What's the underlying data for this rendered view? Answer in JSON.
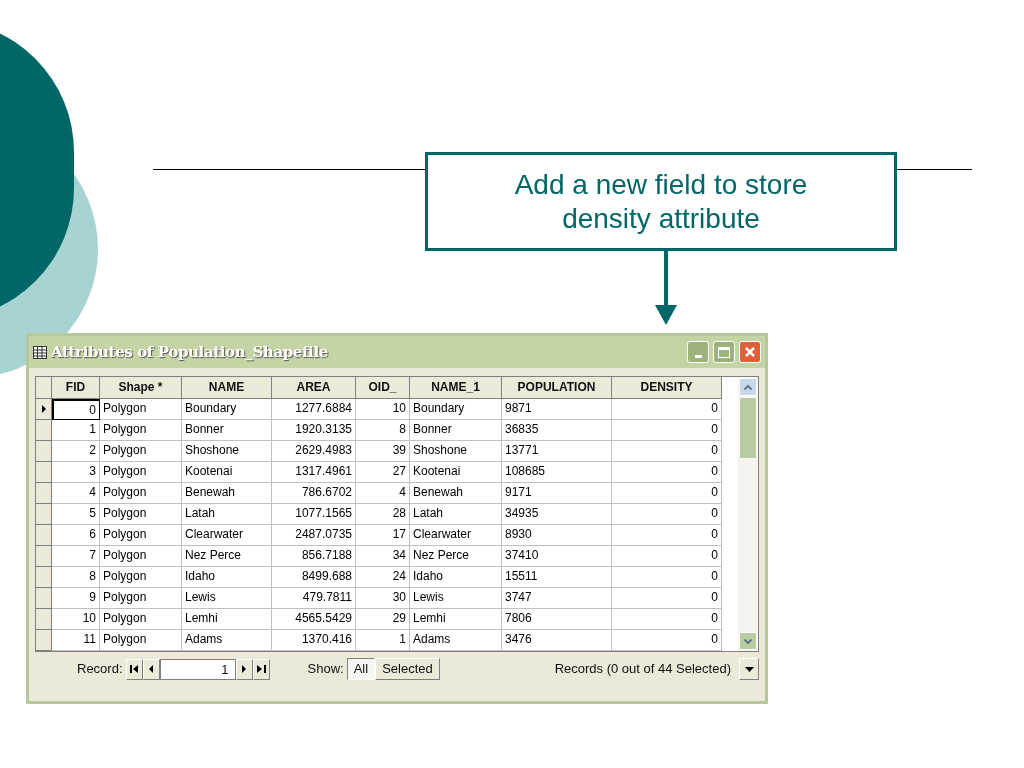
{
  "callout": {
    "text": "Add a new field to store density attribute"
  },
  "window": {
    "title": "Attributes of Population_Shapefile"
  },
  "table": {
    "columns": [
      {
        "label": "FID"
      },
      {
        "label": "Shape *"
      },
      {
        "label": "NAME"
      },
      {
        "label": "AREA"
      },
      {
        "label": "OID_"
      },
      {
        "label": "NAME_1"
      },
      {
        "label": "POPULATION"
      },
      {
        "label": "DENSITY"
      }
    ],
    "rows": [
      {
        "current": true,
        "cells": [
          "0",
          "Polygon",
          "Boundary",
          "1277.6884",
          "10",
          "Boundary",
          "9871",
          "0"
        ]
      },
      {
        "current": false,
        "cells": [
          "1",
          "Polygon",
          "Bonner",
          "1920.3135",
          "8",
          "Bonner",
          "36835",
          "0"
        ]
      },
      {
        "current": false,
        "cells": [
          "2",
          "Polygon",
          "Shoshone",
          "2629.4983",
          "39",
          "Shoshone",
          "13771",
          "0"
        ]
      },
      {
        "current": false,
        "cells": [
          "3",
          "Polygon",
          "Kootenai",
          "1317.4961",
          "27",
          "Kootenai",
          "108685",
          "0"
        ]
      },
      {
        "current": false,
        "cells": [
          "4",
          "Polygon",
          "Benewah",
          "786.6702",
          "4",
          "Benewah",
          "9171",
          "0"
        ]
      },
      {
        "current": false,
        "cells": [
          "5",
          "Polygon",
          "Latah",
          "1077.1565",
          "28",
          "Latah",
          "34935",
          "0"
        ]
      },
      {
        "current": false,
        "cells": [
          "6",
          "Polygon",
          "Clearwater",
          "2487.0735",
          "17",
          "Clearwater",
          "8930",
          "0"
        ]
      },
      {
        "current": false,
        "cells": [
          "7",
          "Polygon",
          "Nez Perce",
          "856.7188",
          "34",
          "Nez Perce",
          "37410",
          "0"
        ]
      },
      {
        "current": false,
        "cells": [
          "8",
          "Polygon",
          "Idaho",
          "8499.688",
          "24",
          "Idaho",
          "15511",
          "0"
        ]
      },
      {
        "current": false,
        "cells": [
          "9",
          "Polygon",
          "Lewis",
          "479.7811",
          "30",
          "Lewis",
          "3747",
          "0"
        ]
      },
      {
        "current": false,
        "cells": [
          "10",
          "Polygon",
          "Lemhi",
          "4565.5429",
          "29",
          "Lemhi",
          "7806",
          "0"
        ]
      },
      {
        "current": false,
        "cells": [
          "11",
          "Polygon",
          "Adams",
          "1370.416",
          "1",
          "Adams",
          "3476",
          "0"
        ]
      }
    ]
  },
  "navigation": {
    "record_label": "Record:",
    "record_value": "1",
    "show_label": "Show:",
    "show_options": [
      {
        "label": "All",
        "selected": true
      },
      {
        "label": "Selected",
        "selected": false
      }
    ],
    "status": "Records (0 out of 44 Selected)"
  }
}
